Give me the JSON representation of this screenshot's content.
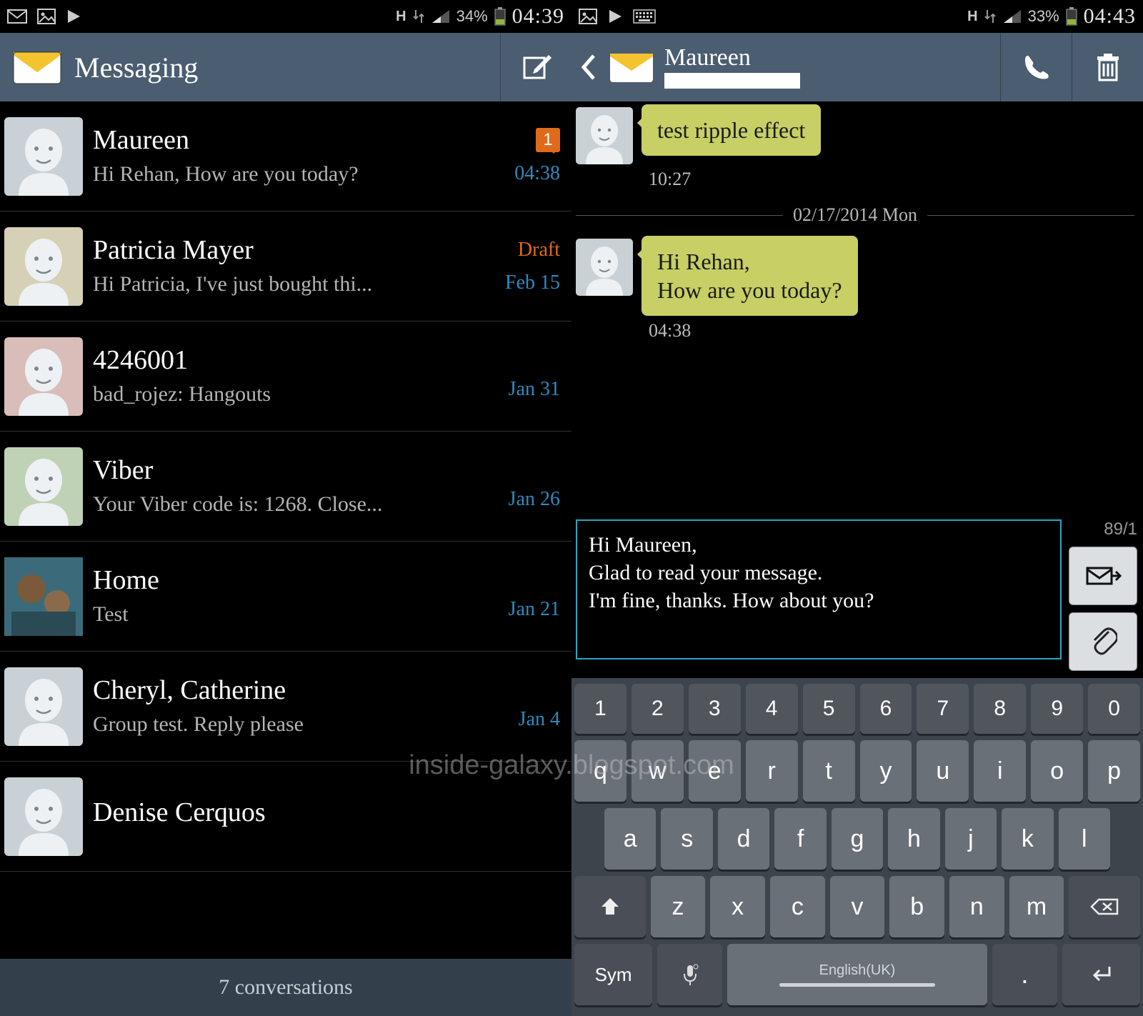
{
  "left": {
    "status": {
      "battery_pct": "34%",
      "time": "04:39"
    },
    "header": {
      "title": "Messaging"
    },
    "conversations": [
      {
        "name": "Maureen",
        "preview": "Hi Rehan, How are you today?",
        "time": "04:38",
        "badge": "1",
        "avatar_bg": "#c9d1d6"
      },
      {
        "name": "Patricia Mayer",
        "preview": "Hi Patricia, I've just bought thi...",
        "time": "Feb 15",
        "draft": "Draft",
        "avatar_bg": "#d6d0b6"
      },
      {
        "name": "4246001",
        "preview": "bad_rojez: Hangouts",
        "time": "Jan 31",
        "avatar_bg": "#d8bdb8"
      },
      {
        "name": "Viber",
        "preview": "Your Viber code is: 1268. Close...",
        "time": "Jan 26",
        "avatar_bg": "#bfd2b5"
      },
      {
        "name": "Home",
        "preview": "Test",
        "time": "Jan 21",
        "photo": true
      },
      {
        "name": "Cheryl, Catherine",
        "preview": "Group test. Reply please",
        "time": "Jan 4",
        "avatar_bg": "#c9d1d6"
      },
      {
        "name": "Denise Cerquos",
        "preview": "",
        "time": "",
        "avatar_bg": "#c9d1d6"
      }
    ],
    "footer": "7 conversations"
  },
  "right": {
    "status": {
      "battery_pct": "33%",
      "time": "04:43"
    },
    "header": {
      "name": "Maureen"
    },
    "messages": [
      {
        "text": "test ripple effect",
        "time": "10:27"
      }
    ],
    "date_divider": "02/17/2014 Mon",
    "messages2": [
      {
        "text": "Hi Rehan,\nHow are you today?",
        "time": "04:38"
      }
    ],
    "compose": {
      "text": "Hi Maureen,\nGlad to read your message.\nI'm fine, thanks. How about you?",
      "counter": "89/1"
    },
    "keyboard": {
      "row_nums": [
        "1",
        "2",
        "3",
        "4",
        "5",
        "6",
        "7",
        "8",
        "9",
        "0"
      ],
      "row2": [
        "q",
        "w",
        "e",
        "r",
        "t",
        "y",
        "u",
        "i",
        "o",
        "p"
      ],
      "row3": [
        "a",
        "s",
        "d",
        "f",
        "g",
        "h",
        "j",
        "k",
        "l"
      ],
      "row4_mid": [
        "z",
        "x",
        "c",
        "v",
        "b",
        "n",
        "m"
      ],
      "sym": "Sym",
      "space": "English(UK)"
    }
  },
  "watermark": "inside-galaxy.blogspot.com"
}
